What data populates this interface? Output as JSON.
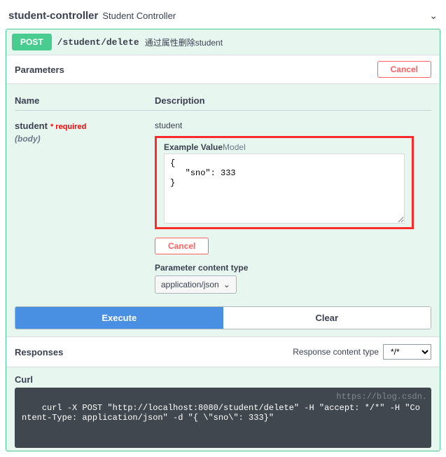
{
  "controller": {
    "name": "student-controller",
    "desc": "Student Controller"
  },
  "op": {
    "method": "POST",
    "path": "/student/delete",
    "summary": "通过属性删除student"
  },
  "params": {
    "header": "Parameters",
    "cancel": "Cancel",
    "cols": {
      "name": "Name",
      "desc": "Description"
    },
    "row": {
      "name": "student",
      "required": "* required",
      "type": "(body)",
      "desc": "student",
      "tabs": {
        "example": "Example Value",
        "model": "Model"
      },
      "body": "{\n   \"sno\": 333\n}",
      "cancel": "Cancel",
      "pct_label": "Parameter content type",
      "pct_value": "application/json"
    }
  },
  "buttons": {
    "execute": "Execute",
    "clear": "Clear"
  },
  "responses": {
    "title": "Responses",
    "rct_label": "Response content type",
    "rct_value": "*/*"
  },
  "curl": {
    "title": "Curl",
    "cmd": "curl -X POST \"http://localhost:8080/student/delete\" -H \"accept: */*\" -H \"Content-Type: application/json\" -d \"{ \\\"sno\\\": 333}\""
  },
  "watermark": "https://blog.csdn."
}
